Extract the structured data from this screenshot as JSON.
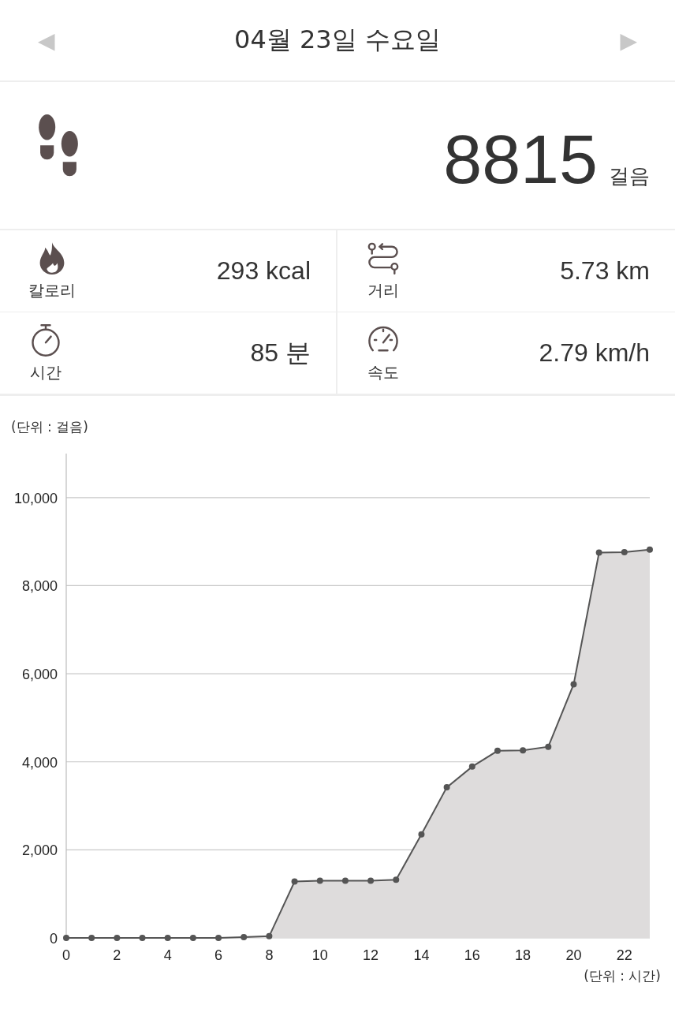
{
  "header": {
    "prev": "◀",
    "date": "04월 23일 수요일",
    "next": "▶"
  },
  "steps": {
    "value": "8815",
    "unit": "걸음"
  },
  "stats": [
    {
      "kind": "calories",
      "label": "칼로리",
      "value": "293 kcal"
    },
    {
      "kind": "distance",
      "label": "거리",
      "value": "5.73 km"
    },
    {
      "kind": "time",
      "label": "시간",
      "value": "85 분"
    },
    {
      "kind": "speed",
      "label": "속도",
      "value": "2.79 km/h"
    }
  ],
  "chart": {
    "unit_y": "(단위 : 걸음)",
    "unit_x": "(단위 : 시간)",
    "chart_data": {
      "type": "area",
      "x": [
        0,
        1,
        2,
        3,
        4,
        5,
        6,
        7,
        8,
        9,
        10,
        11,
        12,
        13,
        14,
        15,
        16,
        17,
        18,
        19,
        20,
        21,
        22,
        23
      ],
      "series": [
        {
          "color": "#555555",
          "values": [
            0,
            0,
            0,
            0,
            0,
            0,
            0,
            20,
            40,
            1280,
            1300,
            1300,
            1300,
            1320,
            2350,
            3420,
            3890,
            4250,
            4260,
            4340,
            5760,
            8750,
            8760,
            8820
          ]
        }
      ],
      "grid": true,
      "xlim": [
        0,
        23
      ],
      "ylim": [
        0,
        11000
      ],
      "xticks": [
        0,
        2,
        4,
        6,
        8,
        10,
        12,
        14,
        16,
        18,
        20,
        22
      ],
      "yticks": [
        {
          "value": 0,
          "label": "0"
        },
        {
          "value": 2000,
          "label": "2,000"
        },
        {
          "value": 4000,
          "label": "4,000"
        },
        {
          "value": 6000,
          "label": "6,000"
        },
        {
          "value": 8000,
          "label": "8,000"
        },
        {
          "value": 10000,
          "label": "10,000"
        }
      ]
    }
  }
}
